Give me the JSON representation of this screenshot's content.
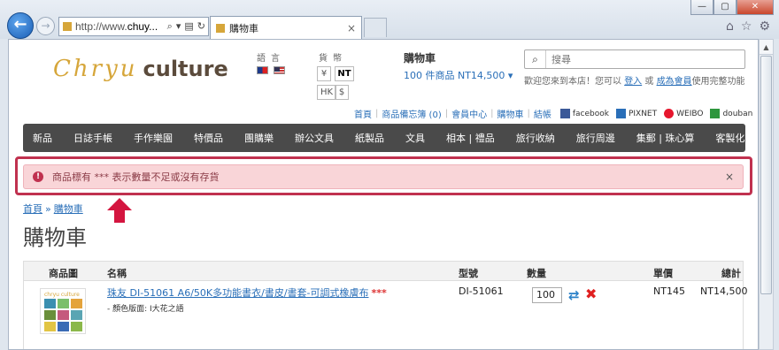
{
  "browser": {
    "address_prefix": "http://www.",
    "address_domain": "chuy...",
    "tab_title": "購物車",
    "tab_close": "×",
    "win_min": "—",
    "win_max": "▢",
    "win_close": "✕",
    "back": "←",
    "fwd": "→"
  },
  "header": {
    "logo_script": "Chryu",
    "logo_word": "culture",
    "language_label": "語言",
    "currency_label": "貨幣",
    "currencies": [
      "¥",
      "NT",
      "HK",
      "$"
    ],
    "cart_title": "購物車",
    "cart_summary": "100 件商品 NT14,500 ▾",
    "search_placeholder": "搜尋",
    "welcome_pre": "歡迎您來到本店！您可以",
    "login": "登入",
    "or": "或",
    "register": "成為會員",
    "welcome_post": "使用完整功能"
  },
  "toplinks": {
    "items": [
      "首頁",
      "商品備忘簿 (0)",
      "會員中心",
      "購物車",
      "結帳"
    ],
    "social": [
      "facebook",
      "PIXNET",
      "WEIBO",
      "douban"
    ]
  },
  "nav": {
    "items": [
      "新品",
      "日誌手帳",
      "手作樂園",
      "特價品",
      "團購樂",
      "辦公文具",
      "紙製品",
      "文具",
      "相本 | 禮品",
      "旅行收納",
      "旅行周邊",
      "集郵 | 珠心算",
      "客製化"
    ]
  },
  "alert": {
    "icon": "!",
    "message": "商品標有 *** 表示數量不足或沒有存貨",
    "close": "×"
  },
  "breadcrumb": {
    "home": "首頁",
    "sep": "»",
    "current": "購物車"
  },
  "page_title": "購物車",
  "table": {
    "headers": {
      "image": "商品圖",
      "name": "名稱",
      "model": "型號",
      "qty": "數量",
      "unit_price": "單價",
      "total": "總計"
    },
    "rows": [
      {
        "name": "珠友 DI-51061 A6/50K多功能書衣/書皮/書套-可調式橡膚布",
        "stars": "***",
        "option": "- 顏色版面: I大花之語",
        "model": "DI-51061",
        "qty": "100",
        "unit_price": "NT145",
        "total": "NT14,500",
        "thumb_label": "chryu culture"
      }
    ]
  },
  "colors": {
    "alert_bg": "#f9d5d8",
    "alert_outline": "#c0314f",
    "nav_bg": "#4a4a4a",
    "link": "#2a6fb8"
  }
}
